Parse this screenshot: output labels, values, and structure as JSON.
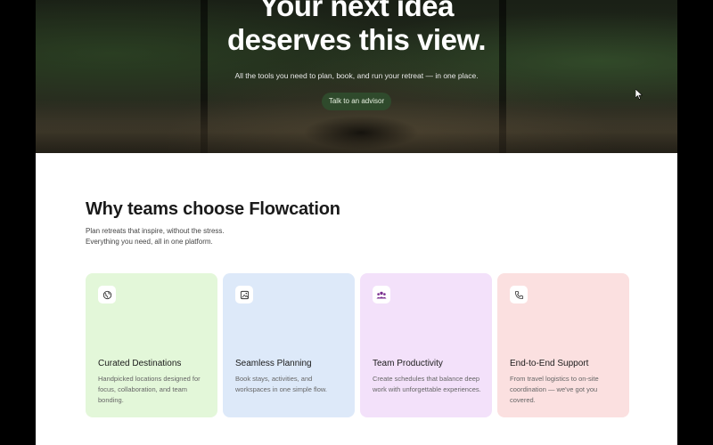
{
  "hero": {
    "title_line1": "Your next idea",
    "title_line2": "deserves this view.",
    "subtitle": "All the tools you need to plan, book, and run your retreat — in one place.",
    "cta_label": "Talk to an advisor"
  },
  "why": {
    "title": "Why teams choose Flowcation",
    "subtitle_line1": "Plan retreats that inspire, without the stress.",
    "subtitle_line2": "Everything you need, all in one platform."
  },
  "cards": [
    {
      "title": "Curated Destinations",
      "description": "Handpicked locations designed for focus, collaboration, and team bonding.",
      "icon": "globe-icon",
      "background": "#e3f7d9"
    },
    {
      "title": "Seamless Planning",
      "description": "Book stays, activities, and workspaces in one simple flow.",
      "icon": "image-icon",
      "background": "#dde9f9"
    },
    {
      "title": "Team Productivity",
      "description": "Create schedules that balance deep work with unforgettable experiences.",
      "icon": "team-icon",
      "background": "#f3e1fa"
    },
    {
      "title": "End-to-End Support",
      "description": "From travel logistics to on-site coordination — we've got you covered.",
      "icon": "phone-icon",
      "background": "#fbe0e0"
    }
  ],
  "colors": {
    "hero_button": "#2f4a2c",
    "page_background": "#ffffff",
    "outer_background": "#000000"
  }
}
